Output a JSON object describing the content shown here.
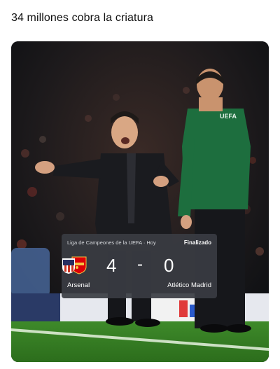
{
  "post": {
    "caption": "34 millones cobra la criatura"
  },
  "photo": {
    "description_icons": [
      "uefa-badge-icon"
    ],
    "badge_text": "UEFA"
  },
  "scorecard": {
    "competition": "Liga de Campeones de la UEFA · Hoy",
    "status": "Finalizado",
    "home_team": "Arsenal",
    "away_team": "Atlético Madrid",
    "home_score": "4",
    "separator": "-",
    "away_score": "0",
    "colors": {
      "card_bg": "#3a3c42",
      "arsenal_red": "#db0007",
      "atletico_red": "#cb3524",
      "atletico_blue": "#272e61"
    }
  }
}
